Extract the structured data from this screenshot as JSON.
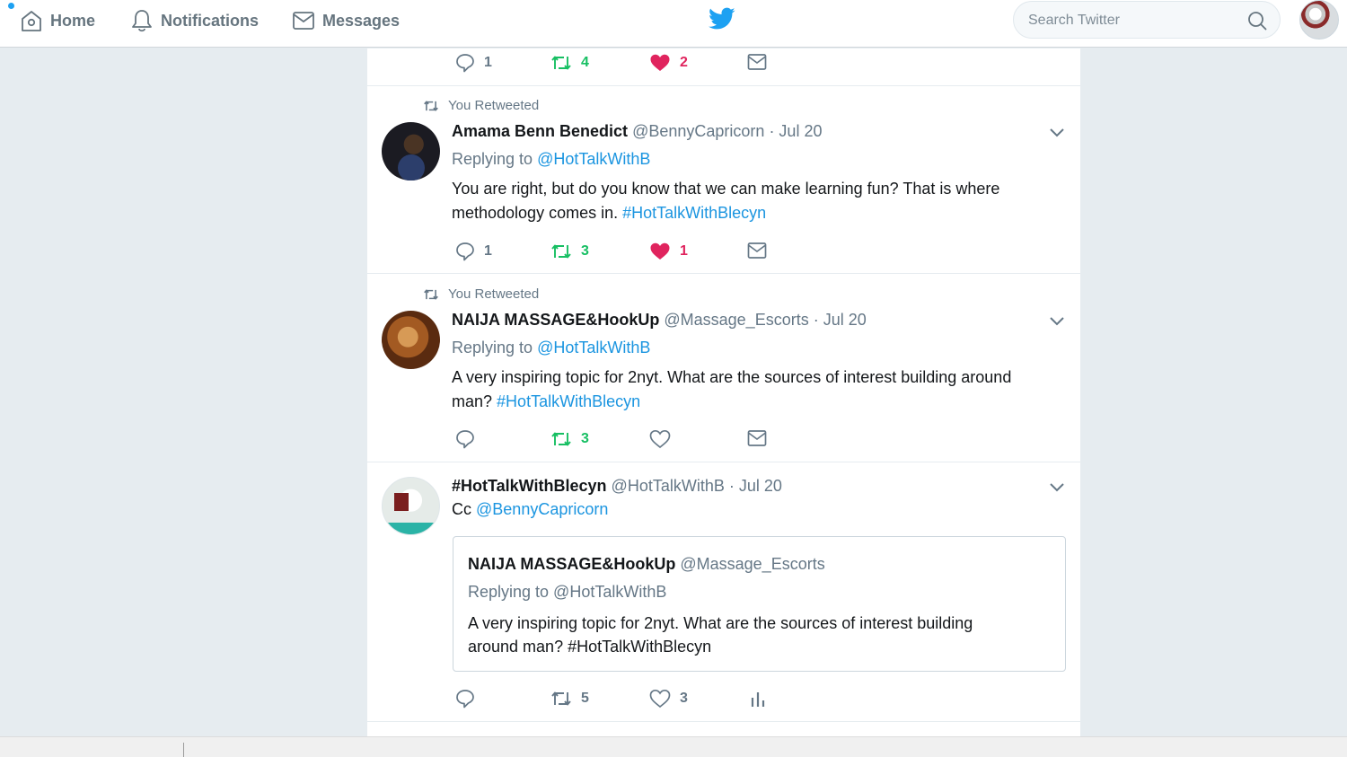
{
  "nav": {
    "home_label": "Home",
    "notifications_label": "Notifications",
    "messages_label": "Messages",
    "search_placeholder": "Search Twitter"
  },
  "colors": {
    "brand_blue": "#1da1f2",
    "link_blue": "#1b95e0",
    "retweet_green": "#17bf63",
    "like_red": "#e0245e",
    "muted_gray": "#657786",
    "background": "#e6ecf0"
  },
  "icons": [
    "home-icon",
    "bell-icon",
    "envelope-icon",
    "twitter-bird-icon",
    "search-icon",
    "reply-icon",
    "retweet-icon",
    "heart-icon",
    "heart-filled-icon",
    "analytics-icon",
    "chevron-down-icon"
  ],
  "top_tweet_actions": {
    "replies": "1",
    "retweets": "4",
    "likes": "2"
  },
  "tweets": [
    {
      "context": "You Retweeted",
      "name": "Amama Benn Benedict",
      "handle": "@BennyCapricorn",
      "date": "· Jul 20",
      "replying_prefix": "Replying to",
      "replying_handle": "@HotTalkWithB",
      "text_line1": "You are right, but do you know that we can make learning fun? That is where",
      "text_line2": "methodology comes in.",
      "hashtag": "#HotTalkWithBlecyn",
      "replies": "1",
      "retweets": "3",
      "likes": "1"
    },
    {
      "context": "You Retweeted",
      "name": "NAIJA MASSAGE&HookUp",
      "handle": "@Massage_Escorts",
      "date": "· Jul 20",
      "replying_prefix": "Replying to",
      "replying_handle": "@HotTalkWithB",
      "text_line1": "A very inspiring topic for 2nyt. What are the sources of interest building around",
      "text_line2": "man?",
      "hashtag": "#HotTalkWithBlecyn",
      "retweets": "3"
    },
    {
      "name": "#HotTalkWithBlecyn",
      "handle": "@HotTalkWithB",
      "date": "· Jul 20",
      "text_prefix": "Cc",
      "mention": "@BennyCapricorn",
      "quote": {
        "name": "NAIJA MASSAGE&HookUp",
        "handle": "@Massage_Escorts",
        "replying": "Replying to @HotTalkWithB",
        "text_line1": "A very inspiring topic for 2nyt. What are the sources of interest building",
        "text_line2": "around man? #HotTalkWithBlecyn"
      },
      "retweets": "5",
      "likes": "3"
    }
  ]
}
